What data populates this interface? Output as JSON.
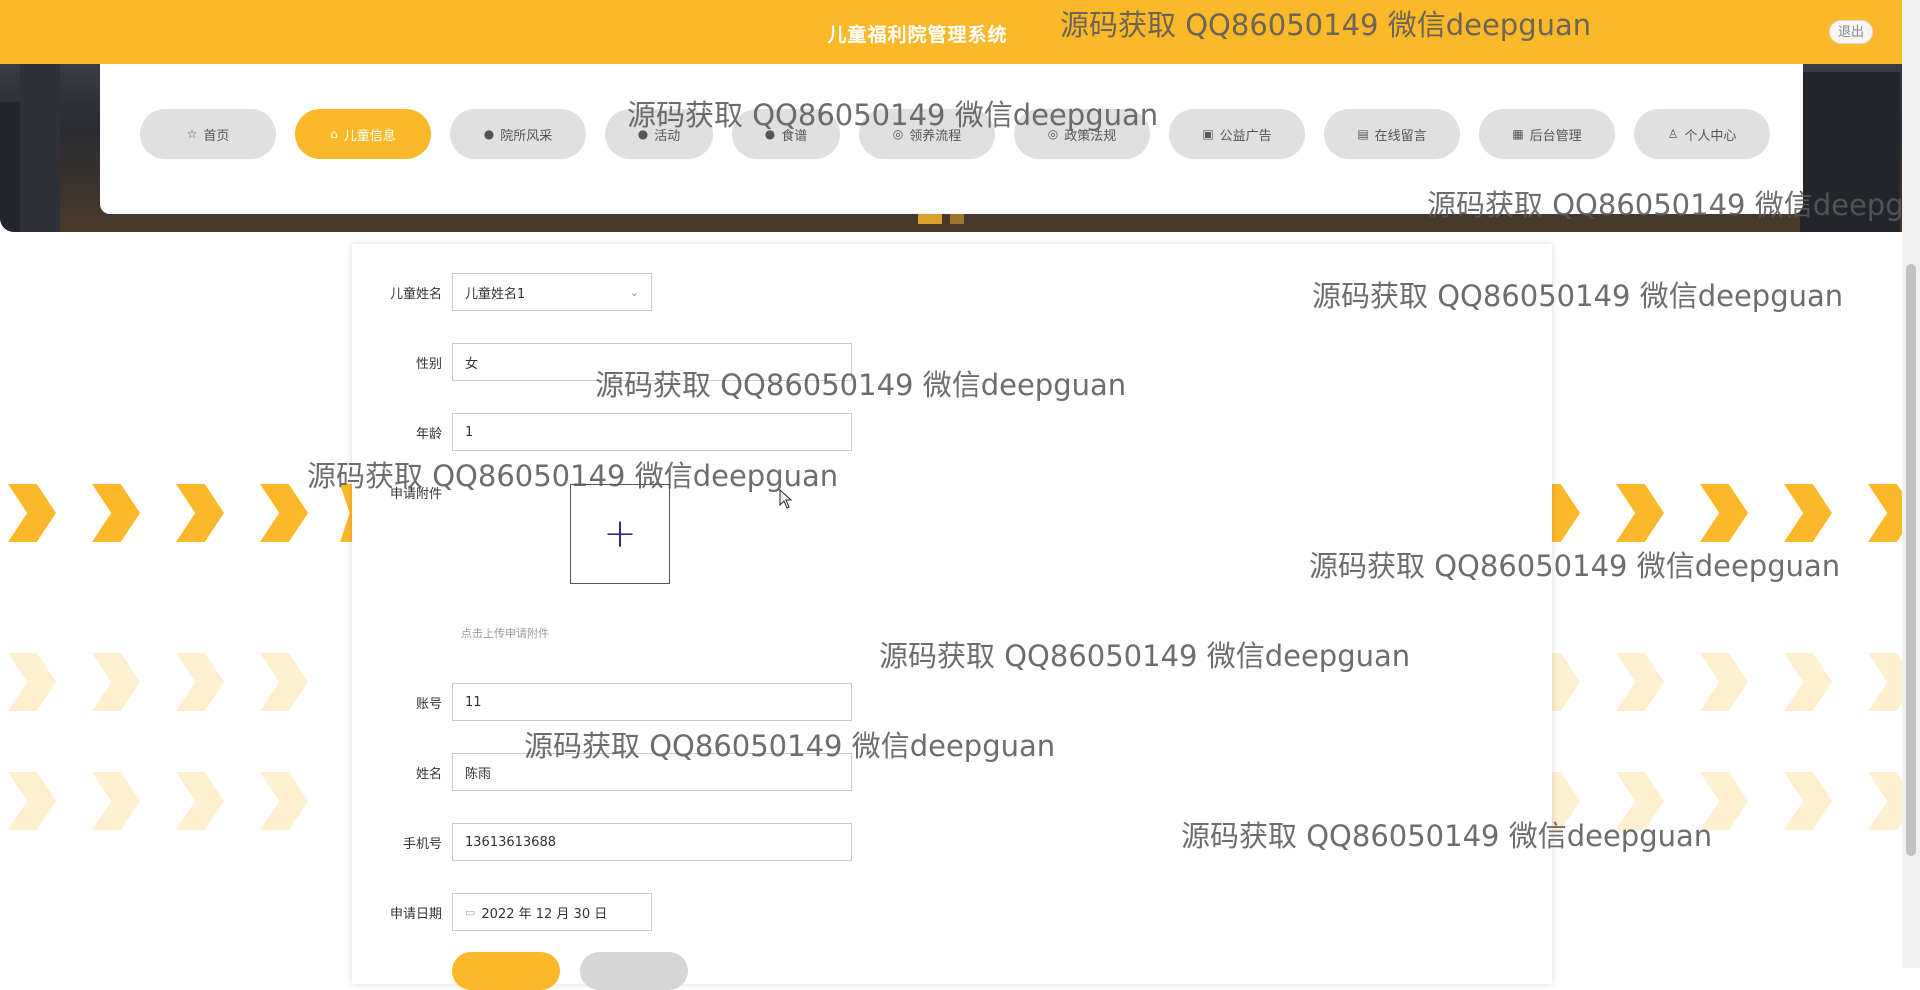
{
  "header": {
    "title": "儿童福利院管理系统",
    "logout_label": "退出"
  },
  "nav": {
    "items": [
      {
        "label": "首页",
        "icon": "☆",
        "active": false
      },
      {
        "label": "儿童信息",
        "icon": "⌂",
        "active": true
      },
      {
        "label": "院所风采",
        "icon": "●",
        "active": false
      },
      {
        "label": "活动",
        "icon": "●",
        "active": false
      },
      {
        "label": "食谱",
        "icon": "●",
        "active": false
      },
      {
        "label": "领养流程",
        "icon": "◎",
        "active": false
      },
      {
        "label": "政策法规",
        "icon": "◎",
        "active": false
      },
      {
        "label": "公益广告",
        "icon": "▣",
        "active": false
      },
      {
        "label": "在线留言",
        "icon": "▤",
        "active": false
      },
      {
        "label": "后台管理",
        "icon": "▦",
        "active": false
      },
      {
        "label": "个人中心",
        "icon": "♙",
        "active": false
      }
    ]
  },
  "form": {
    "child_name": {
      "label": "儿童姓名",
      "value": "儿童姓名1"
    },
    "gender": {
      "label": "性别",
      "value": "女"
    },
    "age": {
      "label": "年龄",
      "value": "1"
    },
    "attachment": {
      "label": "申请附件",
      "hint": "点击上传申请附件"
    },
    "account": {
      "label": "账号",
      "value": "11"
    },
    "name": {
      "label": "姓名",
      "value": "陈雨"
    },
    "phone": {
      "label": "手机号",
      "value": "13613613688"
    },
    "apply_date": {
      "label": "申请日期",
      "value": "2022 年 12 月 30 日"
    }
  },
  "watermark_text": "源码获取 QQ86050149 微信deepguan",
  "colors": {
    "accent": "#fbb829",
    "nav_inactive": "#e0e0e0"
  }
}
